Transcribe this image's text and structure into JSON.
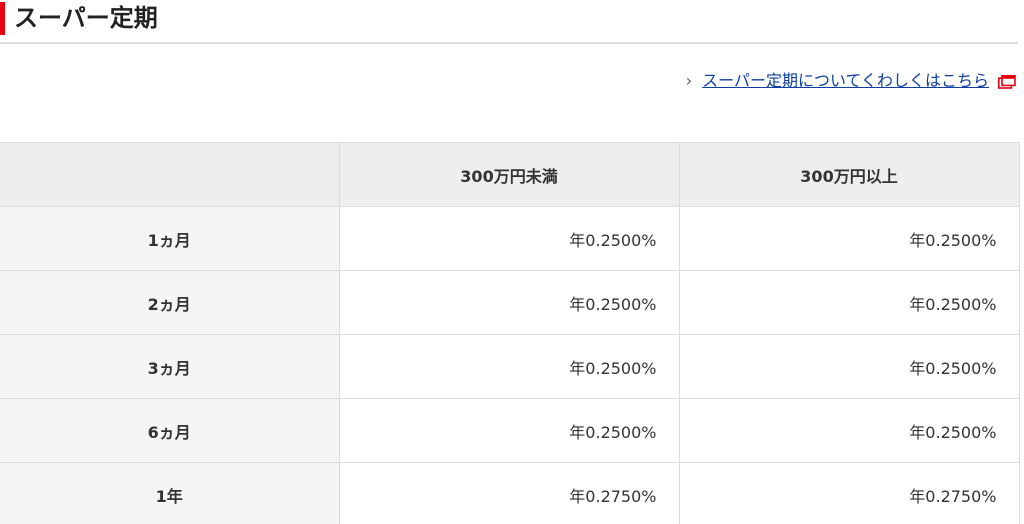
{
  "section": {
    "title": "スーパー定期",
    "accent_color": "#e60012"
  },
  "detail_link": {
    "chevron": "›",
    "label": "スーパー定期についてくわしくはこちら",
    "icon": "new-window-icon",
    "color": "#0e3fa0"
  },
  "table": {
    "headers": [
      "",
      "300万円未満",
      "300万円以上"
    ],
    "rows": [
      {
        "term": "1ヵ月",
        "under_3m": "年0.2500%",
        "over_3m": "年0.2500%"
      },
      {
        "term": "2ヵ月",
        "under_3m": "年0.2500%",
        "over_3m": "年0.2500%"
      },
      {
        "term": "3ヵ月",
        "under_3m": "年0.2500%",
        "over_3m": "年0.2500%"
      },
      {
        "term": "6ヵ月",
        "under_3m": "年0.2500%",
        "over_3m": "年0.2500%"
      },
      {
        "term": "1年",
        "under_3m": "年0.2750%",
        "over_3m": "年0.2750%"
      }
    ]
  }
}
